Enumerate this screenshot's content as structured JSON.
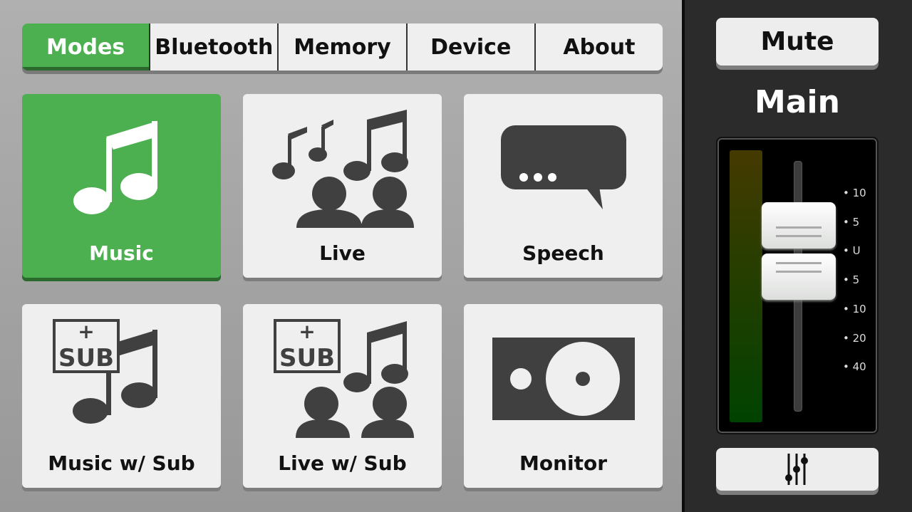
{
  "tabs": [
    {
      "label": "Modes",
      "active": true
    },
    {
      "label": "Bluetooth"
    },
    {
      "label": "Memory"
    },
    {
      "label": "Device"
    },
    {
      "label": "About"
    }
  ],
  "modes": [
    {
      "label": "Music",
      "icon": "music-note-icon",
      "active": true
    },
    {
      "label": "Live",
      "icon": "live-audience-icon"
    },
    {
      "label": "Speech",
      "icon": "speech-bubble-icon"
    },
    {
      "label": "Music w/ Sub",
      "icon": "music-sub-icon"
    },
    {
      "label": "Live w/ Sub",
      "icon": "live-sub-icon"
    },
    {
      "label": "Monitor",
      "icon": "monitor-speaker-icon"
    }
  ],
  "sub_icon_text": "SUB",
  "sub_icon_plus": "+",
  "right": {
    "mute_label": "Mute",
    "channel_label": "Main",
    "mixer_icon": "sliders-icon",
    "fader_scale": [
      "10",
      "5",
      "U",
      "5",
      "10",
      "20",
      "40"
    ]
  },
  "colors": {
    "accent": "#4caf50",
    "tile": "#efefef",
    "icon": "#404040"
  }
}
